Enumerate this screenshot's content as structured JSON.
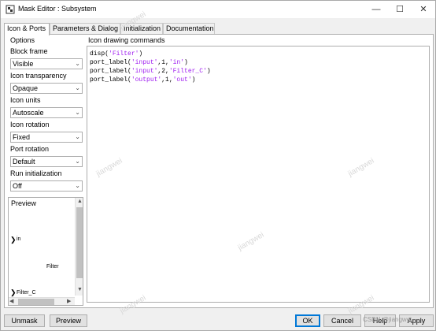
{
  "window": {
    "title": "Mask Editor : Subsystem",
    "controls": {
      "minimize": "—",
      "maximize": "☐",
      "close": "✕"
    }
  },
  "tabs": [
    {
      "label": "Icon & Ports",
      "active": true
    },
    {
      "label": "Parameters & Dialog",
      "active": false
    },
    {
      "label": "Initialization",
      "active": false
    },
    {
      "label": "Documentation",
      "active": false
    }
  ],
  "options": {
    "title": "Options",
    "block_frame": {
      "label": "Block frame",
      "value": "Visible"
    },
    "icon_transparency": {
      "label": "Icon transparency",
      "value": "Opaque"
    },
    "icon_units": {
      "label": "Icon units",
      "value": "Autoscale"
    },
    "icon_rotation": {
      "label": "Icon rotation",
      "value": "Fixed"
    },
    "port_rotation": {
      "label": "Port rotation",
      "value": "Default"
    },
    "run_initialization": {
      "label": "Run initialization",
      "value": "Off"
    }
  },
  "preview": {
    "title": "Preview",
    "block_name": "Filter",
    "ports": [
      {
        "label": "in"
      },
      {
        "label": "Filter_C"
      }
    ]
  },
  "commands": {
    "title": "Icon drawing commands",
    "lines": [
      {
        "pre": "disp(",
        "str": "'Filter'",
        "post": ")"
      },
      {
        "pre": "port_label(",
        "str": "'input'",
        "post": ",1,",
        "str2": "'in'",
        "post2": ")"
      },
      {
        "pre": "port_label(",
        "str": "'input'",
        "post": ",2,",
        "str2": "'Filter_C'",
        "post2": ")"
      },
      {
        "pre": "port_label(",
        "str": "'output'",
        "post": ",1,",
        "str2": "'out'",
        "post2": ")"
      }
    ]
  },
  "buttons": {
    "unmask": "Unmask",
    "preview": "Preview",
    "ok": "OK",
    "cancel": "Cancel",
    "help": "Help",
    "apply": "Apply"
  },
  "watermarks": [
    "jiangwei",
    "jiangwei",
    "jiangwei",
    "jiangwei",
    "jiangwei",
    "jiangwei"
  ],
  "corner_watermark": "CSDN @jiangwei",
  "colors": {
    "string": "#a020f0",
    "default_button": "#0078d7"
  }
}
